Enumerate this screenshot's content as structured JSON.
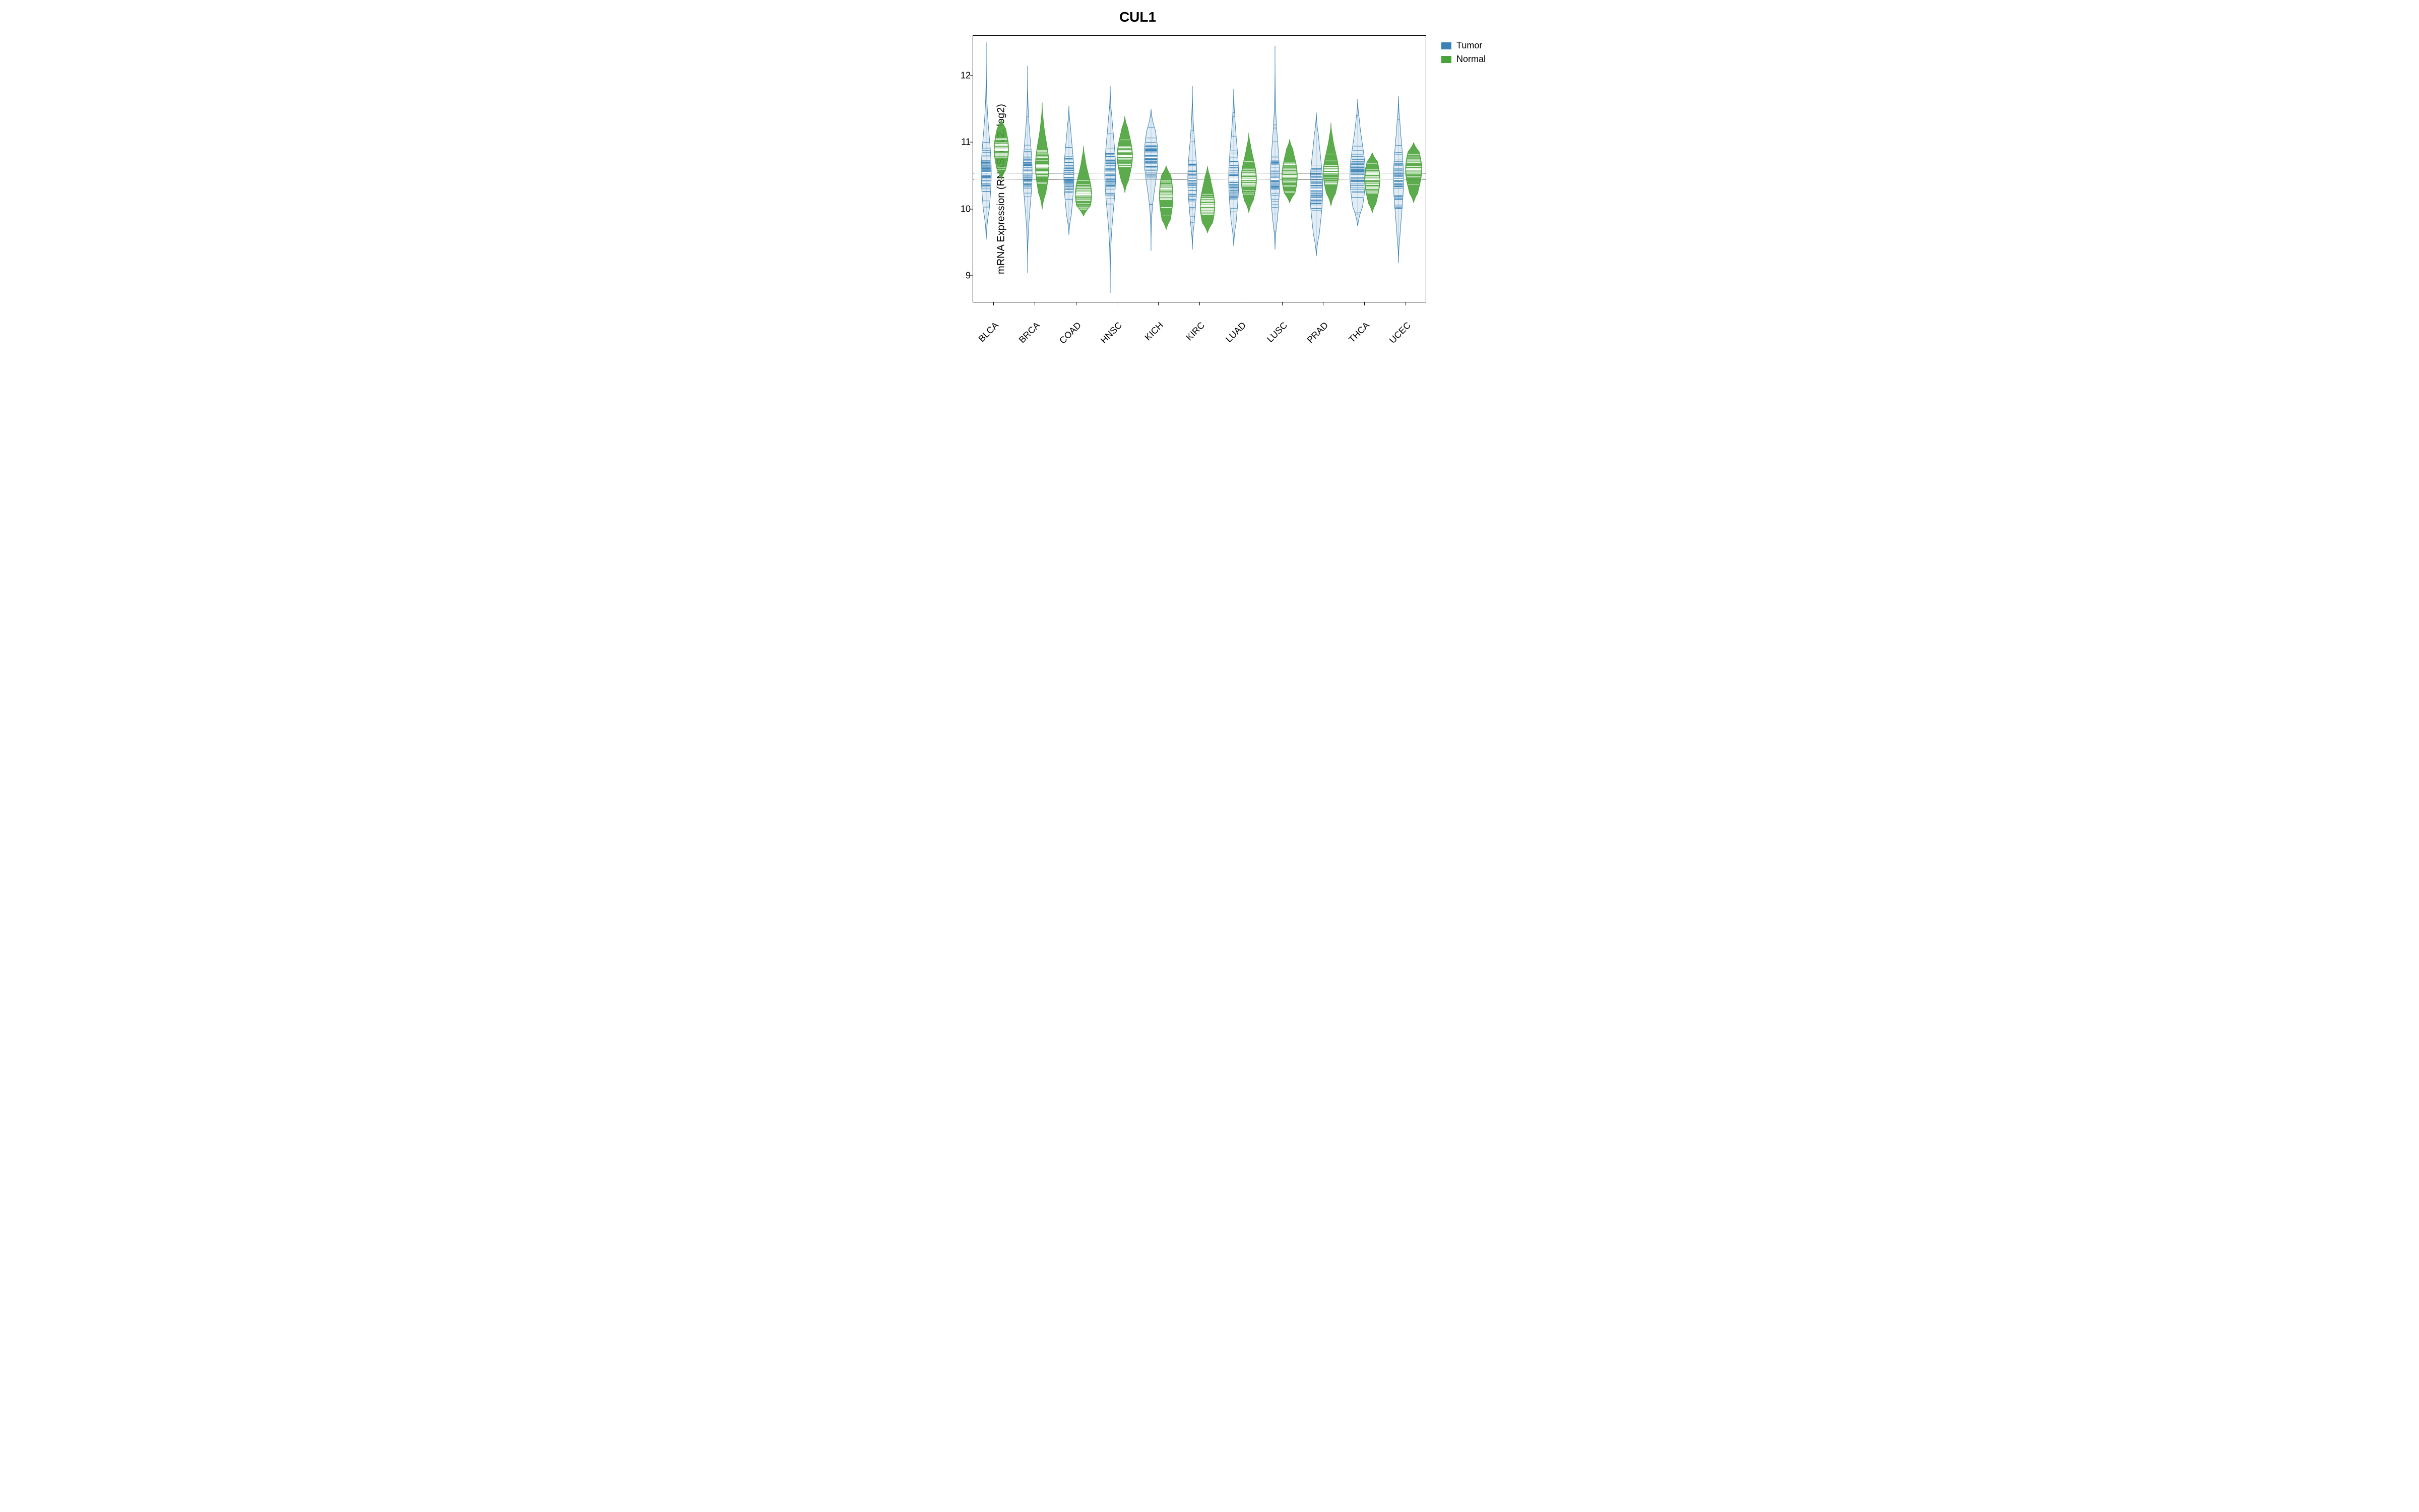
{
  "chart_data": {
    "type": "beanplot",
    "title": "CUL1",
    "ylabel": "mRNA Expression (RNASeq V2, log2)",
    "ylim": [
      8.6,
      12.6
    ],
    "yticks": [
      9,
      10,
      11,
      12
    ],
    "categories": [
      "BLCA",
      "BRCA",
      "COAD",
      "HNSC",
      "KICH",
      "KIRC",
      "LUAD",
      "LUSC",
      "PRAD",
      "THCA",
      "UCEC"
    ],
    "reference_lines": [
      10.46,
      10.55
    ],
    "legend": [
      {
        "name": "Tumor",
        "color": "#3a82b5"
      },
      {
        "name": "Normal",
        "color": "#4aa33a"
      }
    ],
    "series": [
      {
        "name": "Tumor",
        "color": "#3a82b5",
        "medians": [
          10.55,
          10.55,
          10.5,
          10.55,
          10.78,
          10.45,
          10.45,
          10.45,
          10.3,
          10.5,
          10.45
        ],
        "min": [
          9.55,
          9.05,
          9.62,
          8.75,
          9.38,
          9.4,
          9.45,
          9.4,
          9.3,
          9.75,
          9.2
        ],
        "max": [
          12.5,
          12.15,
          11.55,
          11.85,
          11.5,
          11.85,
          11.8,
          12.45,
          11.45,
          11.65,
          11.7
        ],
        "spread": [
          0.45,
          0.4,
          0.4,
          0.45,
          0.35,
          0.4,
          0.45,
          0.45,
          0.45,
          0.4,
          0.45
        ],
        "max_width": [
          0.55,
          0.5,
          0.55,
          0.6,
          0.75,
          0.5,
          0.55,
          0.5,
          0.7,
          0.85,
          0.55
        ]
      },
      {
        "name": "Normal",
        "color": "#4aa33a",
        "medians": [
          10.9,
          10.65,
          10.22,
          10.8,
          10.2,
          10.05,
          10.45,
          10.5,
          10.55,
          10.45,
          10.6
        ],
        "min": [
          10.45,
          10.0,
          9.9,
          10.25,
          9.7,
          9.65,
          9.95,
          10.1,
          10.05,
          9.95,
          10.1
        ],
        "max": [
          11.35,
          11.6,
          10.95,
          11.4,
          10.65,
          10.65,
          11.15,
          11.05,
          11.3,
          10.85,
          11.0
        ],
        "spread": [
          0.25,
          0.3,
          0.25,
          0.25,
          0.3,
          0.25,
          0.25,
          0.25,
          0.25,
          0.25,
          0.25
        ],
        "max_width": [
          0.8,
          0.75,
          0.9,
          0.85,
          0.75,
          0.8,
          0.85,
          0.85,
          0.85,
          0.85,
          0.9
        ]
      }
    ]
  }
}
